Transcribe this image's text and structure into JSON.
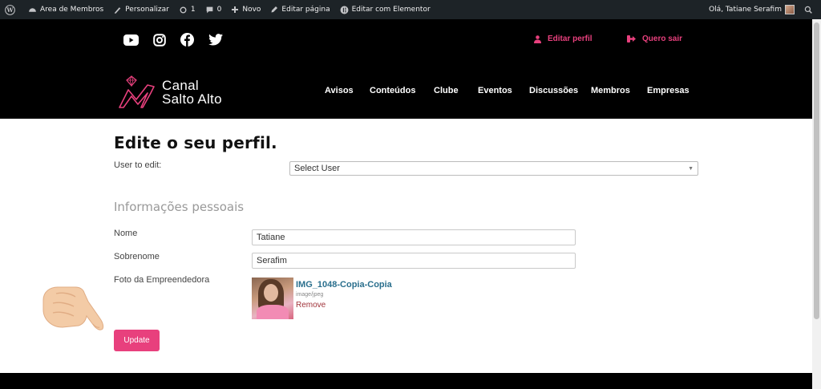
{
  "adminbar": {
    "wp_icon": "wordpress-icon",
    "site_name": "Area de Membros",
    "customize": "Personalizar",
    "updates_count": "1",
    "comments_count": "0",
    "new": "Novo",
    "edit_page": "Editar página",
    "edit_elementor": "Editar com Elementor",
    "greeting": "Olá, Tatiane Serafim"
  },
  "header": {
    "social": [
      "youtube-icon",
      "instagram-icon",
      "facebook-icon",
      "twitter-icon"
    ],
    "edit_profile": "Editar perfil",
    "logout": "Quero sair",
    "logo_line1": "Canal",
    "logo_line2": "Salto Alto",
    "nav": [
      "Avisos",
      "Conteúdos",
      "Clube",
      "Eventos",
      "Discussões",
      "Membros",
      "Empresas"
    ]
  },
  "main": {
    "title": "Edite o seu perfil.",
    "user_to_edit_label": "User to edit:",
    "select_value": "Select User",
    "section_title": "Informações pessoais",
    "nome_label": "Nome",
    "nome_value": "Tatiane",
    "sobrenome_label": "Sobrenome",
    "sobrenome_value": "Serafim",
    "foto_label": "Foto da Empreendedora",
    "file_name": "IMG_1048-Copia-Copia",
    "file_type": "image/jpeg",
    "remove": "Remove",
    "update": "Update"
  },
  "colors": {
    "accent": "#e8407d",
    "header_bg": "#000000",
    "adminbar_bg": "#1d2327",
    "link": "#2a6f8d",
    "remove": "#a0333a"
  }
}
